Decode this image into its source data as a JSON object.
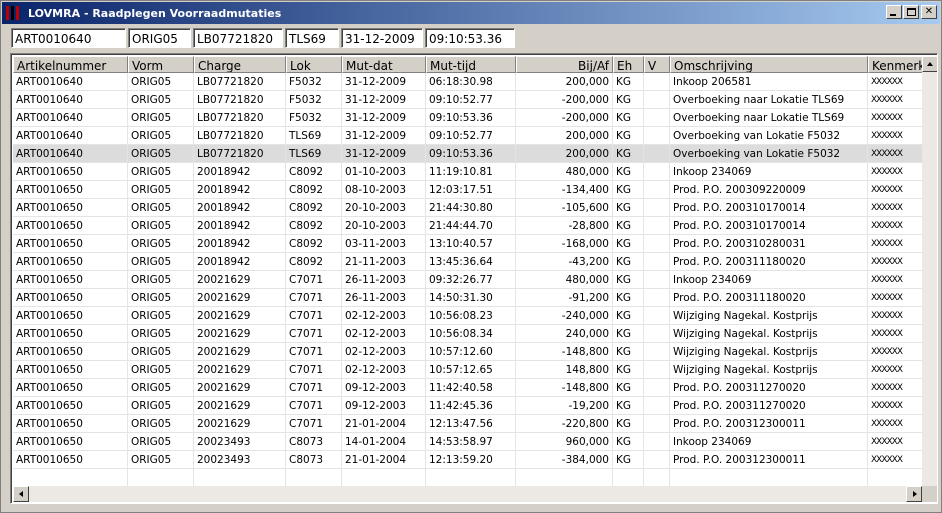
{
  "window": {
    "title": "LOVMRA - Raadplegen Voorraadmutaties",
    "minimize_icon": "minimize-icon",
    "maximize_icon": "maximize-icon",
    "close_icon": "close-icon"
  },
  "header": {
    "artikelnummer": "ART0010640",
    "vorm": "ORIG05",
    "charge": "LB07721820",
    "lok": "TLS69",
    "mut_dat": "31-12-2009",
    "mut_tijd": "09:10:53.36"
  },
  "table": {
    "columns": [
      "Artikelnummer",
      "Vorm",
      "Charge",
      "Lok",
      "Mut-dat",
      "Mut-tijd",
      "Bij/Af",
      "Eh",
      "V",
      "Omschrijving",
      "Kenmerk"
    ],
    "selected_row": 4,
    "rows": [
      [
        "ART0010640",
        "ORIG05",
        "LB07721820",
        "F5032",
        "31-12-2009",
        "06:18:30.98",
        "200,000",
        "KG",
        "",
        "Inkoop 206581",
        "XXXXXX"
      ],
      [
        "ART0010640",
        "ORIG05",
        "LB07721820",
        "F5032",
        "31-12-2009",
        "09:10:52.77",
        "-200,000",
        "KG",
        "",
        "Overboeking naar Lokatie TLS69",
        "XXXXXX"
      ],
      [
        "ART0010640",
        "ORIG05",
        "LB07721820",
        "F5032",
        "31-12-2009",
        "09:10:53.36",
        "-200,000",
        "KG",
        "",
        "Overboeking naar Lokatie TLS69",
        "XXXXXX"
      ],
      [
        "ART0010640",
        "ORIG05",
        "LB07721820",
        "TLS69",
        "31-12-2009",
        "09:10:52.77",
        "200,000",
        "KG",
        "",
        "Overboeking van Lokatie F5032",
        "XXXXXX"
      ],
      [
        "ART0010640",
        "ORIG05",
        "LB07721820",
        "TLS69",
        "31-12-2009",
        "09:10:53.36",
        "200,000",
        "KG",
        "",
        "Overboeking van Lokatie F5032",
        "XXXXXX"
      ],
      [
        "ART0010650",
        "ORIG05",
        "20018942",
        "C8092",
        "01-10-2003",
        "11:19:10.81",
        "480,000",
        "KG",
        "",
        "Inkoop 234069",
        "XXXXXX"
      ],
      [
        "ART0010650",
        "ORIG05",
        "20018942",
        "C8092",
        "08-10-2003",
        "12:03:17.51",
        "-134,400",
        "KG",
        "",
        "Prod. P.O. 200309220009",
        "XXXXXX"
      ],
      [
        "ART0010650",
        "ORIG05",
        "20018942",
        "C8092",
        "20-10-2003",
        "21:44:30.80",
        "-105,600",
        "KG",
        "",
        "Prod. P.O. 200310170014",
        "XXXXXX"
      ],
      [
        "ART0010650",
        "ORIG05",
        "20018942",
        "C8092",
        "20-10-2003",
        "21:44:44.70",
        "-28,800",
        "KG",
        "",
        "Prod. P.O. 200310170014",
        "XXXXXX"
      ],
      [
        "ART0010650",
        "ORIG05",
        "20018942",
        "C8092",
        "03-11-2003",
        "13:10:40.57",
        "-168,000",
        "KG",
        "",
        "Prod. P.O. 200310280031",
        "XXXXXX"
      ],
      [
        "ART0010650",
        "ORIG05",
        "20018942",
        "C8092",
        "21-11-2003",
        "13:45:36.64",
        "-43,200",
        "KG",
        "",
        "Prod. P.O. 200311180020",
        "XXXXXX"
      ],
      [
        "ART0010650",
        "ORIG05",
        "20021629",
        "C7071",
        "26-11-2003",
        "09:32:26.77",
        "480,000",
        "KG",
        "",
        "Inkoop 234069",
        "XXXXXX"
      ],
      [
        "ART0010650",
        "ORIG05",
        "20021629",
        "C7071",
        "26-11-2003",
        "14:50:31.30",
        "-91,200",
        "KG",
        "",
        "Prod. P.O. 200311180020",
        "XXXXXX"
      ],
      [
        "ART0010650",
        "ORIG05",
        "20021629",
        "C7071",
        "02-12-2003",
        "10:56:08.23",
        "-240,000",
        "KG",
        "",
        "Wijziging Nagekal. Kostprijs",
        "XXXXXX"
      ],
      [
        "ART0010650",
        "ORIG05",
        "20021629",
        "C7071",
        "02-12-2003",
        "10:56:08.34",
        "240,000",
        "KG",
        "",
        "Wijziging Nagekal. Kostprijs",
        "XXXXXX"
      ],
      [
        "ART0010650",
        "ORIG05",
        "20021629",
        "C7071",
        "02-12-2003",
        "10:57:12.60",
        "-148,800",
        "KG",
        "",
        "Wijziging Nagekal. Kostprijs",
        "XXXXXX"
      ],
      [
        "ART0010650",
        "ORIG05",
        "20021629",
        "C7071",
        "02-12-2003",
        "10:57:12.65",
        "148,800",
        "KG",
        "",
        "Wijziging Nagekal. Kostprijs",
        "XXXXXX"
      ],
      [
        "ART0010650",
        "ORIG05",
        "20021629",
        "C7071",
        "09-12-2003",
        "11:42:40.58",
        "-148,800",
        "KG",
        "",
        "Prod. P.O. 200311270020",
        "XXXXXX"
      ],
      [
        "ART0010650",
        "ORIG05",
        "20021629",
        "C7071",
        "09-12-2003",
        "11:42:45.36",
        "-19,200",
        "KG",
        "",
        "Prod. P.O. 200311270020",
        "XXXXXX"
      ],
      [
        "ART0010650",
        "ORIG05",
        "20021629",
        "C7071",
        "21-01-2004",
        "12:13:47.56",
        "-220,800",
        "KG",
        "",
        "Prod. P.O. 200312300011",
        "XXXXXX"
      ],
      [
        "ART0010650",
        "ORIG05",
        "20023493",
        "C8073",
        "14-01-2004",
        "14:53:58.97",
        "960,000",
        "KG",
        "",
        "Inkoop 234069",
        "XXXXXX"
      ],
      [
        "ART0010650",
        "ORIG05",
        "20023493",
        "C8073",
        "21-01-2004",
        "12:13:59.20",
        "-384,000",
        "KG",
        "",
        "Prod. P.O. 200312300011",
        "XXXXXX"
      ]
    ]
  },
  "scrollbars": {
    "up_icon": "scroll-up-arrow-icon",
    "left_icon": "scroll-left-arrow-icon",
    "right_icon": "scroll-right-arrow-icon"
  }
}
